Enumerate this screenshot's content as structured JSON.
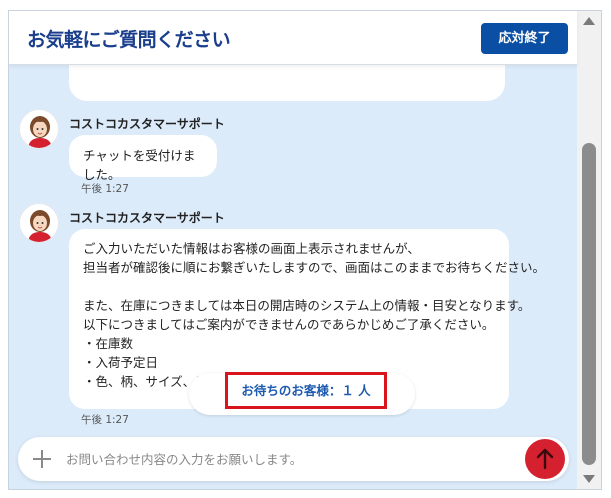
{
  "header": {
    "title": "お気軽にご質問ください",
    "end_button": "応対終了"
  },
  "messages": [
    {
      "sender": "コストコカスタマーサポート",
      "lines": [
        "チャットを受付けました。"
      ],
      "time": "午後 1:27"
    },
    {
      "sender": "コストコカスタマーサポート",
      "lines": [
        "ご入力いただいた情報はお客様の画面上表示されませんが、",
        "担当者が確認後に順にお繋ぎいたしますので、画面はこのままでお待ちください。",
        "",
        "また、在庫につきましては本日の開店時のシステム上の情報・目安となります。",
        "以下につきましてはご案内ができませんのであらかじめご了承ください。",
        "・在庫数",
        "・入荷予定日",
        "・色、柄、サイズ、デザ"
      ],
      "time": "午後 1:27"
    }
  ],
  "waiting": {
    "text": "お待ちのお客様：１ 人"
  },
  "input": {
    "placeholder": "お問い合わせ内容の入力をお願いします。",
    "value": ""
  },
  "colors": {
    "accent": "#0a4fa3",
    "send": "#d4202f",
    "chat_bg": "#dcebfa",
    "highlight": "#d9141d"
  },
  "icons": {
    "attach": "plus-icon",
    "send": "arrow-up-icon",
    "agent": "avatar-agent-icon"
  }
}
